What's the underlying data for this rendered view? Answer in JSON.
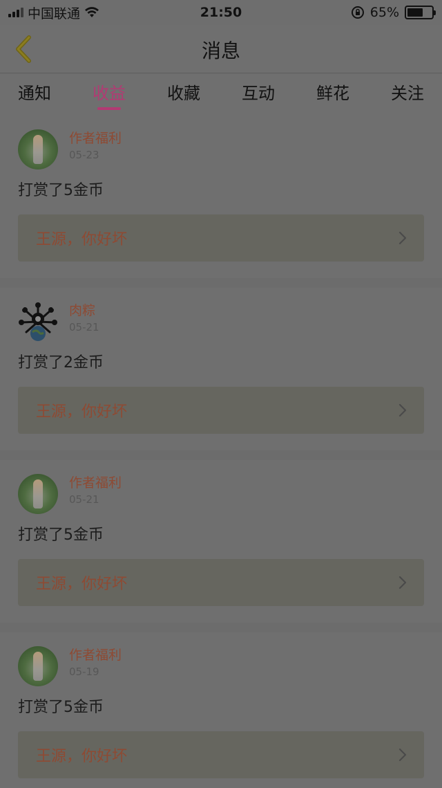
{
  "status_bar": {
    "carrier": "中国联通",
    "time": "21:50",
    "battery": "65%",
    "icons": [
      "signal-icon",
      "wifi-icon",
      "orientation-lock-icon",
      "battery-icon"
    ]
  },
  "nav": {
    "title": "消息",
    "back_icon": "chevron-left-icon"
  },
  "tabs": [
    {
      "label": "通知",
      "active": false
    },
    {
      "label": "收益",
      "active": true
    },
    {
      "label": "收藏",
      "active": false
    },
    {
      "label": "互动",
      "active": false
    },
    {
      "label": "鲜花",
      "active": false
    },
    {
      "label": "关注",
      "active": false
    }
  ],
  "messages": [
    {
      "author": "作者福利",
      "date": "05-23",
      "content": "打赏了5金币",
      "quote": "王源，你好坏",
      "avatar": "girl-avatar"
    },
    {
      "author": "肉粽",
      "date": "05-21",
      "content": "打赏了2金币",
      "quote": "王源，你好坏",
      "avatar": "virus-globe-avatar"
    },
    {
      "author": "作者福利",
      "date": "05-21",
      "content": "打赏了5金币",
      "quote": "王源，你好坏",
      "avatar": "girl-avatar"
    },
    {
      "author": "作者福利",
      "date": "05-19",
      "content": "打赏了5金币",
      "quote": "王源，你好坏",
      "avatar": "girl-avatar"
    }
  ],
  "colors": {
    "accent": "#b23a73",
    "author": "#8e4a33",
    "overlay_bg": "#6c6c6c"
  }
}
